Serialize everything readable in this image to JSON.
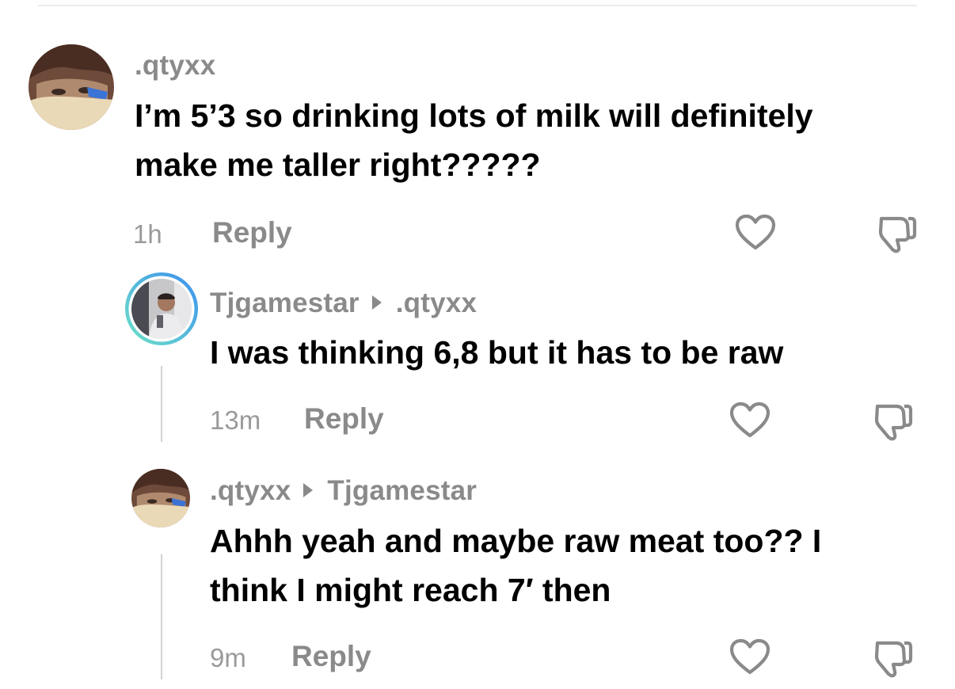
{
  "comments": [
    {
      "username": ".qtyxx",
      "text_lines": [
        "I’m 5’3 so drinking lots of milk will definitely",
        "make me taller right?????"
      ],
      "time": "1h",
      "reply_label": "Reply",
      "like_icon": "heart-outline-icon",
      "dislike_icon": "thumbs-down-icon"
    },
    {
      "username": "Tjgamestar",
      "reply_to": ".qtyxx",
      "text_lines": [
        "I was thinking 6,8 but it has to be raw"
      ],
      "time": "13m",
      "reply_label": "Reply",
      "like_icon": "heart-outline-icon",
      "dislike_icon": "thumbs-down-icon"
    },
    {
      "username": ".qtyxx",
      "reply_to": "Tjgamestar",
      "text_lines": [
        "Ahhh yeah and maybe raw meat too?? I",
        "think I might reach 7′ then"
      ],
      "time": "9m",
      "reply_label": "Reply",
      "like_icon": "heart-outline-icon",
      "dislike_icon": "thumbs-down-icon"
    }
  ],
  "colors": {
    "secondary_text": "#8a8a8a",
    "story_ring_start": "#6fe3c6",
    "story_ring_end": "#3a8ff0"
  }
}
